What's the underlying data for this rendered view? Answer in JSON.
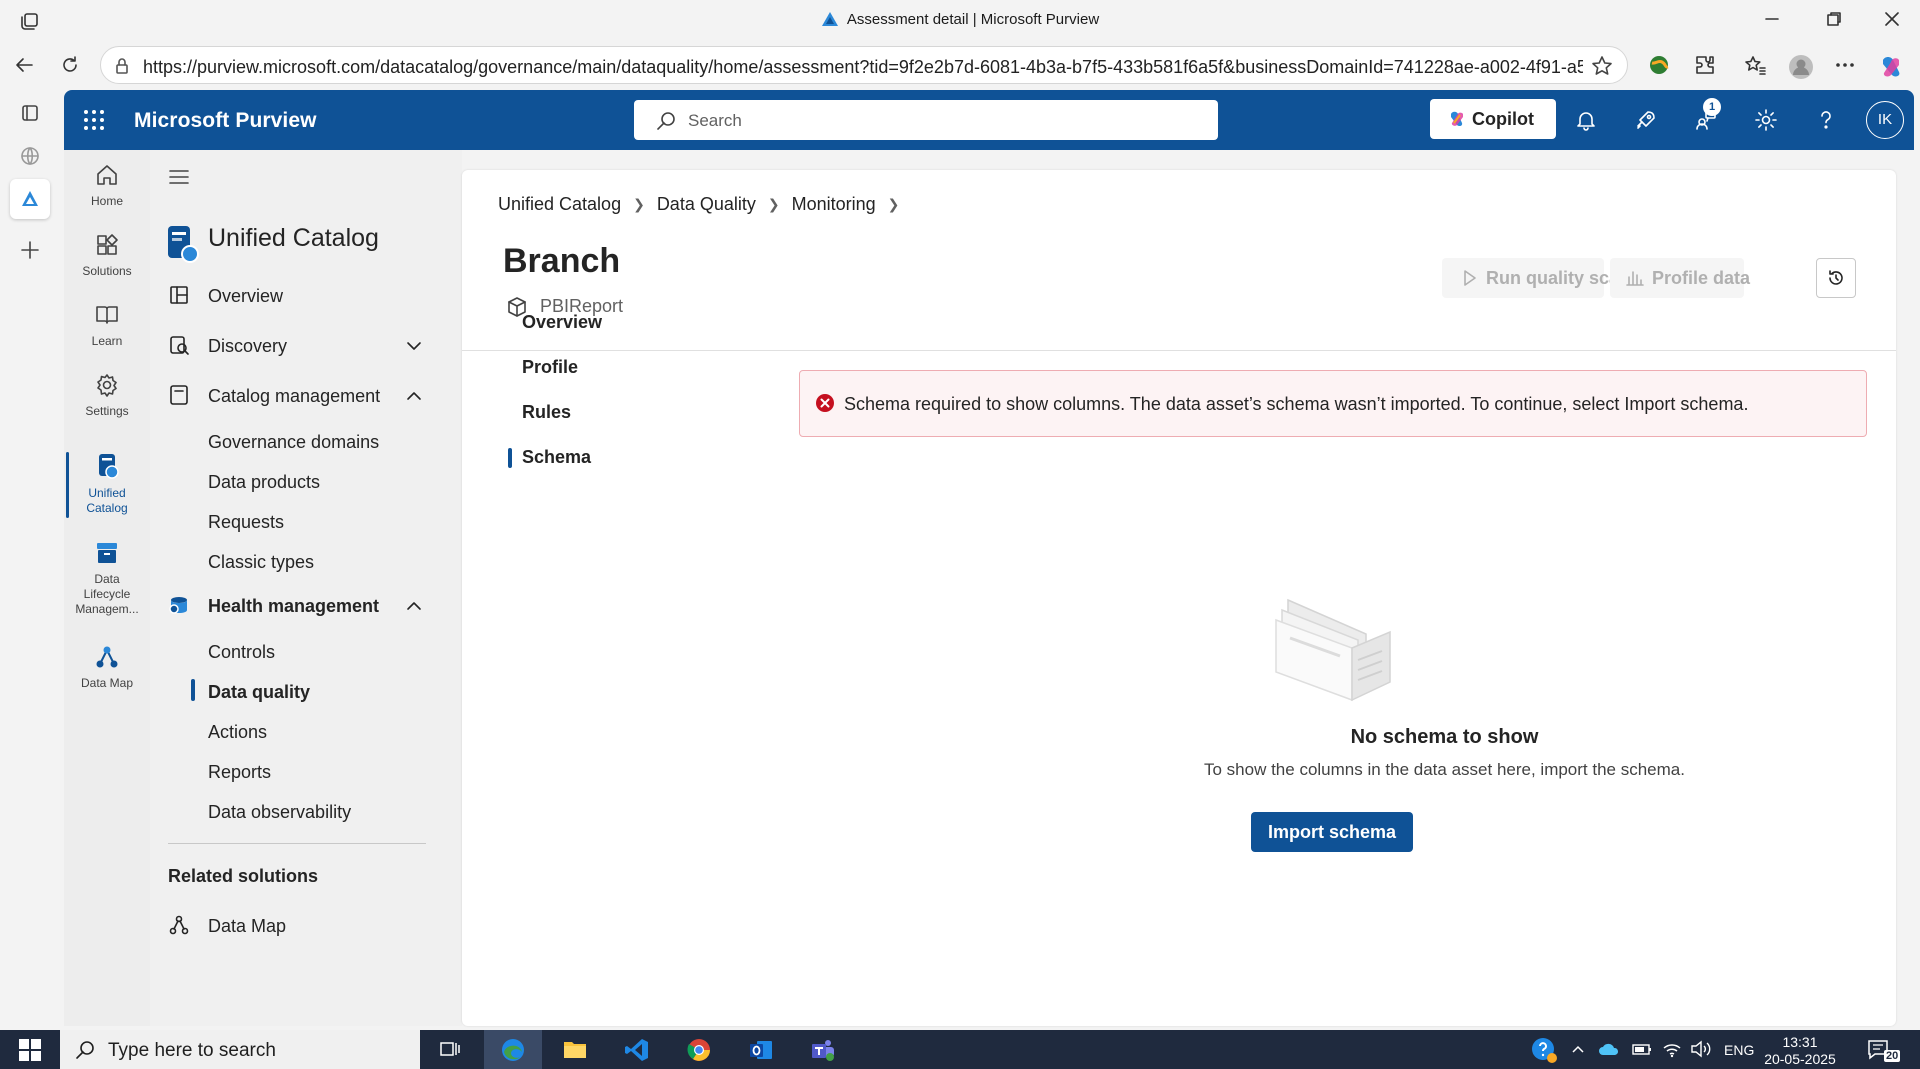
{
  "window": {
    "title": "Assessment detail | Microsoft Purview"
  },
  "browser": {
    "url": "https://purview.microsoft.com/datacatalog/governance/main/dataquality/home/assessment?tid=9f2e2b7d-6081-4b3a-b7f5-433b581f6a5f&businessDomainId=741228ae-a002-4f91-a5..."
  },
  "header": {
    "brand": "Microsoft Purview",
    "search_placeholder": "Search",
    "copilot_label": "Copilot",
    "notification_badge": "1",
    "avatar_initials": "IK",
    "accent": "#0f5296"
  },
  "rail": {
    "items": [
      {
        "label": "Home",
        "icon": "home-icon"
      },
      {
        "label": "Solutions",
        "icon": "solutions-icon"
      },
      {
        "label": "Learn",
        "icon": "book-icon"
      },
      {
        "label": "Settings",
        "icon": "gear-icon"
      },
      {
        "label": "Unified\nCatalog",
        "icon": "catalog-icon"
      },
      {
        "label": "Data\nLifecycle\nManagem...",
        "icon": "archive-icon"
      },
      {
        "label": "Data Map",
        "icon": "data-map-icon"
      }
    ]
  },
  "nav": {
    "title": "Unified Catalog",
    "overview": "Overview",
    "discovery": "Discovery",
    "catalog_management": "Catalog management",
    "catalog_sub": [
      "Governance domains",
      "Data products",
      "Requests",
      "Classic types"
    ],
    "health_management": "Health management",
    "health_sub": [
      "Controls",
      "Data quality",
      "Actions",
      "Reports",
      "Data observability"
    ],
    "related_solutions": "Related solutions",
    "data_map": "Data Map"
  },
  "main": {
    "breadcrumb": [
      "Unified Catalog",
      "Data Quality",
      "Monitoring"
    ],
    "title": "Branch",
    "asset": "PBIReport",
    "run_scan": "Run quality scan",
    "profile_data": "Profile data",
    "tabs": [
      "Overview",
      "Profile",
      "Rules",
      "Schema"
    ],
    "active_tab": "Schema",
    "error_message": "Schema required to show columns. The data asset’s schema wasn’t imported. To continue, select Import schema.",
    "empty_title": "No schema to show",
    "empty_desc": "To show the columns in the data asset here, import the schema.",
    "import_button": "Import schema"
  },
  "taskbar": {
    "search_placeholder": "Type here to search",
    "language": "ENG",
    "time": "13:31",
    "date": "20-05-2025",
    "notifications": "20"
  }
}
